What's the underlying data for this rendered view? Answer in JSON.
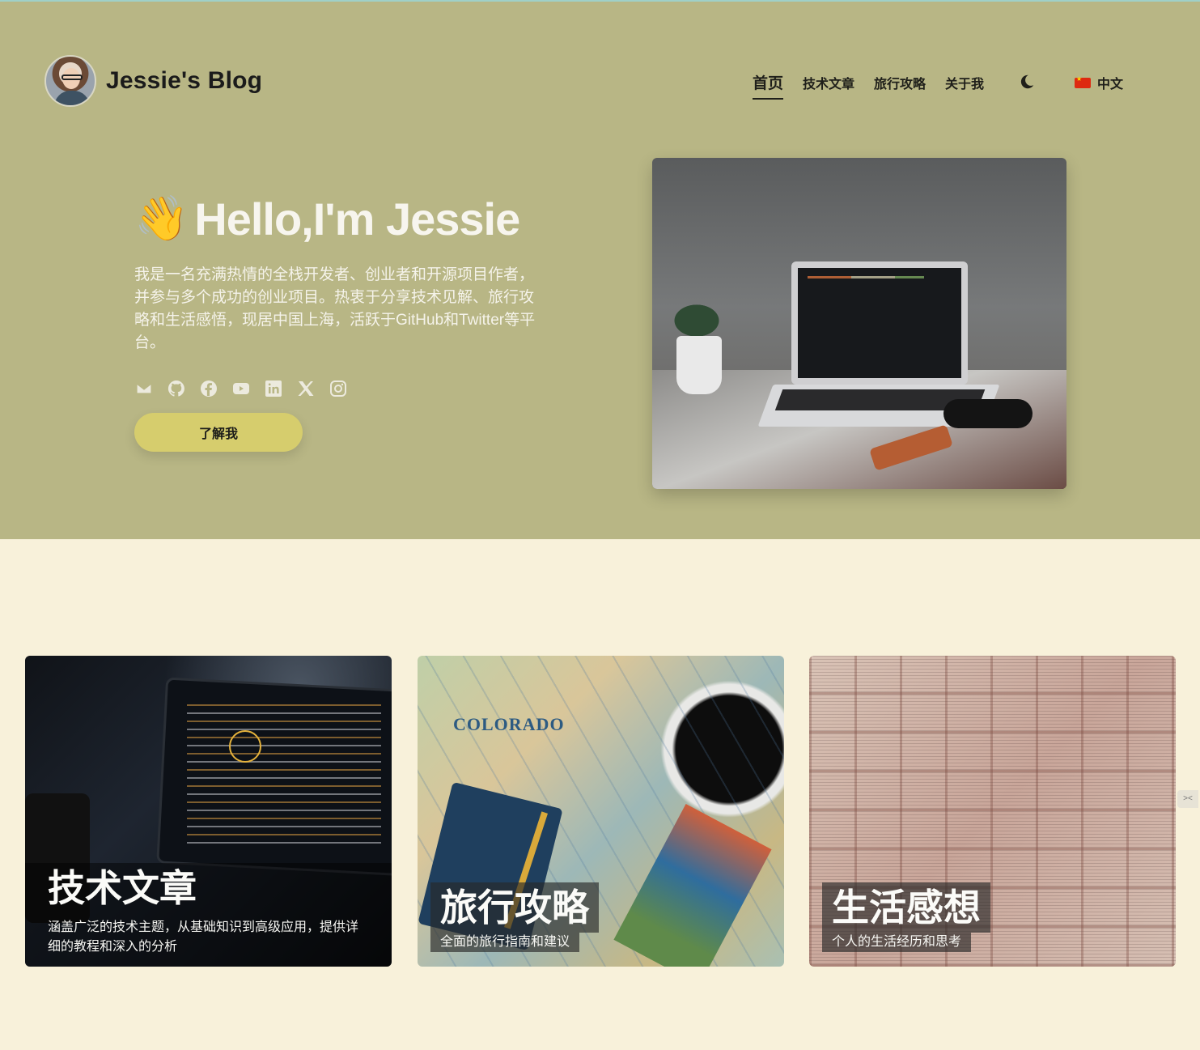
{
  "header": {
    "brand_name": "Jessie's Blog",
    "nav": [
      {
        "label": "首页",
        "active": true
      },
      {
        "label": "技术文章",
        "active": false
      },
      {
        "label": "旅行攻略",
        "active": false
      },
      {
        "label": "关于我",
        "active": false
      }
    ],
    "theme_icon": "moon-icon",
    "language": {
      "flag": "china-flag-icon",
      "label": "中文"
    }
  },
  "hero": {
    "greeting_emoji": "👋",
    "title": "Hello,I'm Jessie",
    "intro": "我是一名充满热情的全栈开发者、创业者和开源项目作者，并参与多个成功的创业项目。热衷于分享技术见解、旅行攻略和生活感悟，现居中国上海，活跃于GitHub和Twitter等平台。",
    "socials": [
      "mail-icon",
      "github-icon",
      "facebook-icon",
      "youtube-icon",
      "linkedin-icon",
      "x-icon",
      "instagram-icon"
    ],
    "cta_label": "了解我"
  },
  "cards": [
    {
      "title": "技术文章",
      "desc": "涵盖广泛的技术主题，从基础知识到高级应用，提供详细的教程和深入的分析"
    },
    {
      "title": "旅行攻略",
      "desc": "全面的旅行指南和建议",
      "map_label": "COLORADO"
    },
    {
      "title": "生活感想",
      "desc": "个人的生活经历和思考"
    }
  ],
  "side_tab": "><",
  "colors": {
    "hero_bg": "#b8b685",
    "page_bg": "#f8f1da",
    "button_bg": "#d6cd6d"
  }
}
